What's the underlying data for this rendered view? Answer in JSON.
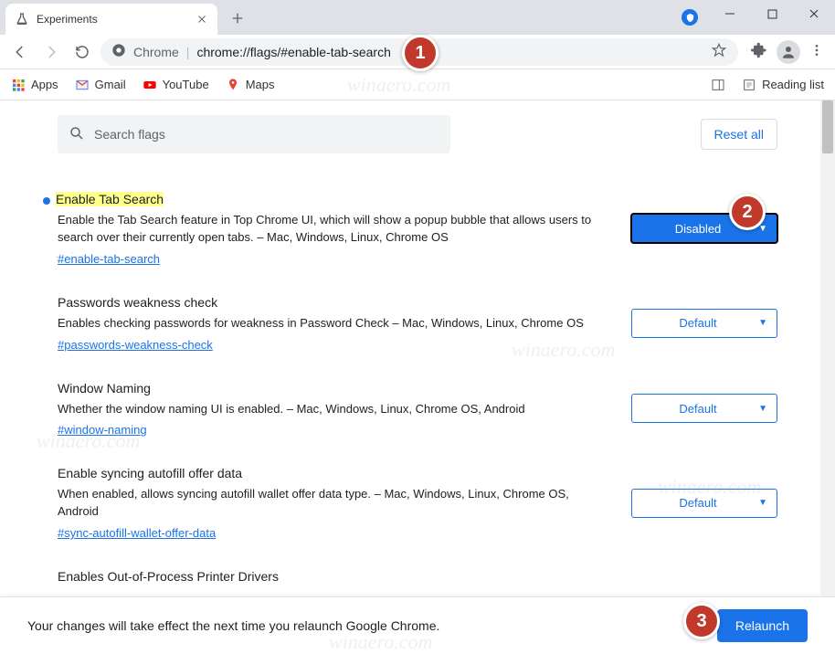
{
  "window": {
    "tab_title": "Experiments"
  },
  "omnibox": {
    "label": "Chrome",
    "url": "chrome://flags/#enable-tab-search"
  },
  "bookmarks": {
    "apps": "Apps",
    "gmail": "Gmail",
    "youtube": "YouTube",
    "maps": "Maps",
    "reading_list": "Reading list"
  },
  "search": {
    "placeholder": "Search flags",
    "reset_label": "Reset all"
  },
  "flags": [
    {
      "title": "Enable Tab Search",
      "highlighted": true,
      "has_dot": true,
      "desc": "Enable the Tab Search feature in Top Chrome UI, which will show a popup bubble that allows users to search over their currently open tabs. – Mac, Windows, Linux, Chrome OS",
      "hash": "#enable-tab-search",
      "select_value": "Disabled",
      "select_active": true
    },
    {
      "title": "Passwords weakness check",
      "highlighted": false,
      "has_dot": false,
      "desc": "Enables checking passwords for weakness in Password Check – Mac, Windows, Linux, Chrome OS",
      "hash": "#passwords-weakness-check",
      "select_value": "Default",
      "select_active": false
    },
    {
      "title": "Window Naming",
      "highlighted": false,
      "has_dot": false,
      "desc": "Whether the window naming UI is enabled. – Mac, Windows, Linux, Chrome OS, Android",
      "hash": "#window-naming",
      "select_value": "Default",
      "select_active": false
    },
    {
      "title": "Enable syncing autofill offer data",
      "highlighted": false,
      "has_dot": false,
      "desc": "When enabled, allows syncing autofill wallet offer data type. – Mac, Windows, Linux, Chrome OS, Android",
      "hash": "#sync-autofill-wallet-offer-data",
      "select_value": "Default",
      "select_active": false
    },
    {
      "title": "Enables Out-of-Process Printer Drivers",
      "highlighted": false,
      "has_dot": false,
      "desc": "",
      "hash": "",
      "select_value": "",
      "select_active": false
    }
  ],
  "footer": {
    "message": "Your changes will take effect the next time you relaunch Google Chrome.",
    "relaunch_label": "Relaunch"
  },
  "badges": {
    "b1": "1",
    "b2": "2",
    "b3": "3"
  },
  "watermark": "winaero.com"
}
